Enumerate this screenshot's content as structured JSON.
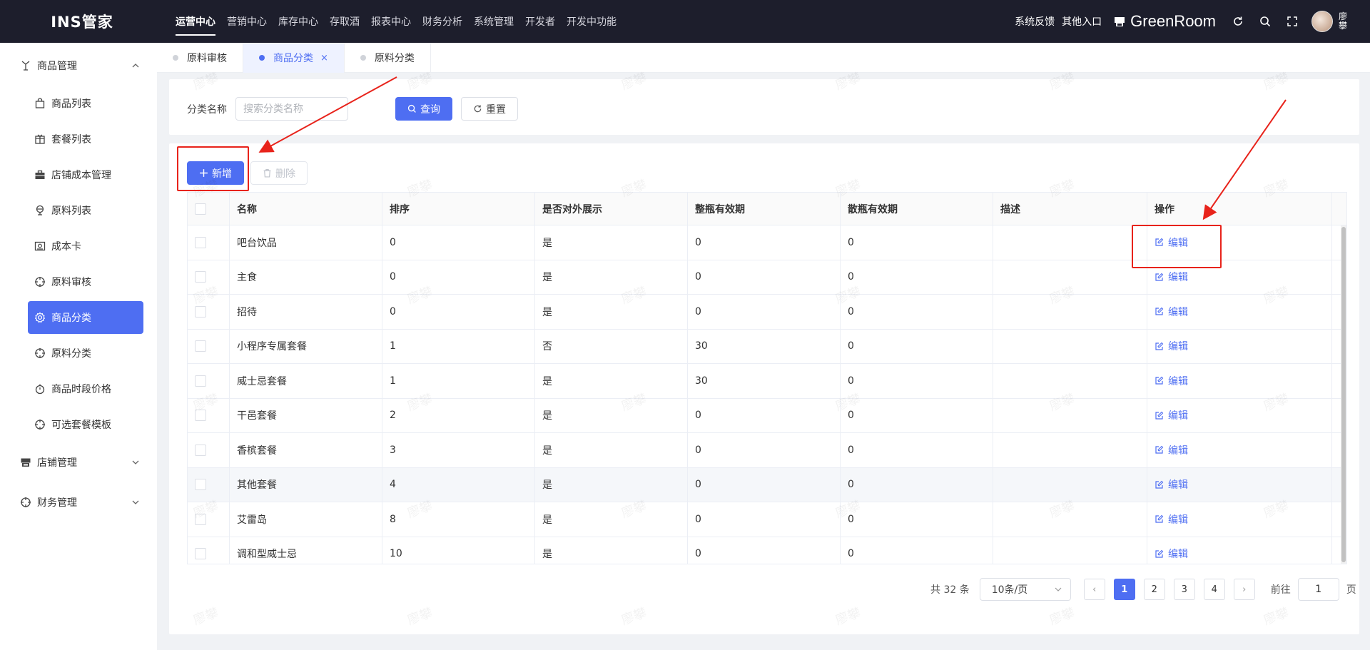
{
  "app": {
    "brand": "INS管家"
  },
  "topnav": [
    {
      "label": "运营中心",
      "active": true
    },
    {
      "label": "营销中心"
    },
    {
      "label": "库存中心"
    },
    {
      "label": "存取酒"
    },
    {
      "label": "报表中心"
    },
    {
      "label": "财务分析"
    },
    {
      "label": "系统管理"
    },
    {
      "label": "开发者"
    },
    {
      "label": "开发中功能"
    }
  ],
  "topright": {
    "feedback": "系统反馈",
    "other_entry": "其他入口",
    "store_name": "GreenRoom",
    "username": "廖攀"
  },
  "sidebar": {
    "groups": [
      {
        "label": "商品管理",
        "icon": "product-icon",
        "expanded": true,
        "items": [
          {
            "label": "商品列表",
            "icon": "bag-icon"
          },
          {
            "label": "套餐列表",
            "icon": "package-icon"
          },
          {
            "label": "店铺成本管理",
            "icon": "briefcase-icon"
          },
          {
            "label": "原料列表",
            "icon": "material-icon"
          },
          {
            "label": "成本卡",
            "icon": "card-icon"
          },
          {
            "label": "原料审核",
            "icon": "crosshair-icon"
          },
          {
            "label": "商品分类",
            "icon": "gear-icon",
            "active": true
          },
          {
            "label": "原料分类",
            "icon": "crosshair-icon"
          },
          {
            "label": "商品时段价格",
            "icon": "clock-icon"
          },
          {
            "label": "可选套餐模板",
            "icon": "crosshair-icon"
          }
        ]
      },
      {
        "label": "店铺管理",
        "icon": "store-icon",
        "expanded": false
      },
      {
        "label": "财务管理",
        "icon": "crosshair-icon",
        "expanded": false
      }
    ]
  },
  "tabs": [
    {
      "label": "原料审核"
    },
    {
      "label": "商品分类",
      "active": true,
      "closable": true,
      "close_glyph": "×"
    },
    {
      "label": "原料分类"
    }
  ],
  "filter": {
    "label": "分类名称",
    "placeholder": "搜索分类名称",
    "value": "",
    "query_label": "查询",
    "reset_label": "重置"
  },
  "toolbar": {
    "add_label": "新增",
    "delete_label": "删除"
  },
  "table": {
    "columns": [
      "名称",
      "排序",
      "是否对外展示",
      "整瓶有效期",
      "散瓶有效期",
      "描述",
      "操作"
    ],
    "action_label": "编辑",
    "rows": [
      {
        "name": "吧台饮品",
        "sort": "0",
        "show": "是",
        "whole": "0",
        "loose": "0",
        "desc": ""
      },
      {
        "name": "主食",
        "sort": "0",
        "show": "是",
        "whole": "0",
        "loose": "0",
        "desc": ""
      },
      {
        "name": "招待",
        "sort": "0",
        "show": "是",
        "whole": "0",
        "loose": "0",
        "desc": ""
      },
      {
        "name": "小程序专属套餐",
        "sort": "1",
        "show": "否",
        "whole": "30",
        "loose": "0",
        "desc": ""
      },
      {
        "name": "威士忌套餐",
        "sort": "1",
        "show": "是",
        "whole": "30",
        "loose": "0",
        "desc": ""
      },
      {
        "name": "干邑套餐",
        "sort": "2",
        "show": "是",
        "whole": "0",
        "loose": "0",
        "desc": ""
      },
      {
        "name": "香槟套餐",
        "sort": "3",
        "show": "是",
        "whole": "0",
        "loose": "0",
        "desc": ""
      },
      {
        "name": "其他套餐",
        "sort": "4",
        "show": "是",
        "whole": "0",
        "loose": "0",
        "desc": ""
      },
      {
        "name": "艾雷岛",
        "sort": "8",
        "show": "是",
        "whole": "0",
        "loose": "0",
        "desc": ""
      },
      {
        "name": "调和型威士忌",
        "sort": "10",
        "show": "是",
        "whole": "0",
        "loose": "0",
        "desc": ""
      }
    ]
  },
  "pagination": {
    "total": "共 32 条",
    "page_size": "10条/页",
    "pages": [
      "1",
      "2",
      "3",
      "4"
    ],
    "current": "1",
    "prev": "‹",
    "next": "›",
    "goto_label": "前往",
    "goto_value": "1",
    "page_suffix": "页"
  },
  "watermark": "廖攀",
  "colors": {
    "primary": "#4e6ef2",
    "topbar": "#1d1e2c",
    "annotation": "#e8231b"
  }
}
